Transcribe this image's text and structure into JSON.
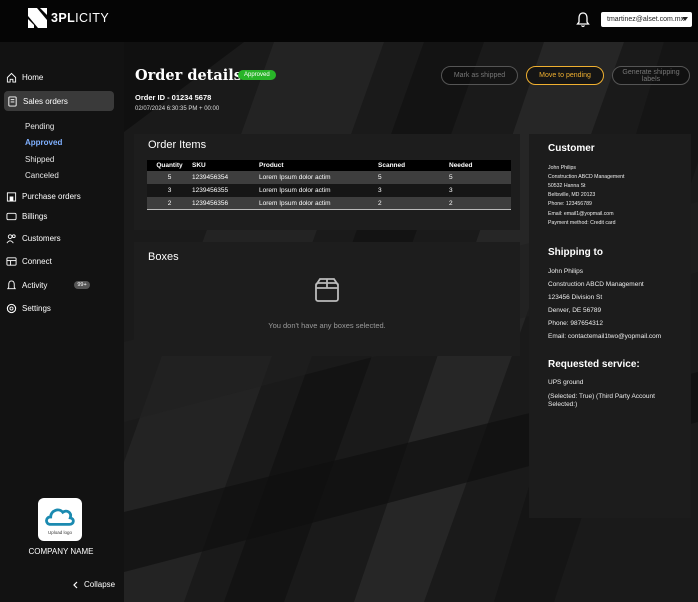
{
  "app": {
    "logo_text_bold": "3PL",
    "logo_text_thin": "ICITY",
    "user_email": "tmartinez@alset.com.mx"
  },
  "sidebar": {
    "home": "Home",
    "sales_orders": "Sales orders",
    "sub": [
      "Pending",
      "Approved",
      "Shipped",
      "Canceled"
    ],
    "purchase_orders": "Purchase orders",
    "billings": "Billings",
    "customers": "Customers",
    "connect": "Connect",
    "activity": "Activity",
    "activity_badge": "99+",
    "settings": "Settings",
    "upload_logo": "Upload logo",
    "company_name": "COMPANY NAME",
    "collapse": "Collapse"
  },
  "order": {
    "title": "Order details",
    "status": "Approved",
    "id_line": "Order ID - 01234 5678",
    "date_line": "02/07/2024 6:30:35 PM + 00:00"
  },
  "actions": {
    "mark_shipped": "Mark as shipped",
    "move_pending": "Move to pending",
    "generate_labels": "Generate shipping labels"
  },
  "items": {
    "title": "Order Items",
    "columns": [
      "Quantity",
      "SKU",
      "Product",
      "Scanned",
      "Needed"
    ],
    "rows": [
      [
        "5",
        "1239456354",
        "Lorem Ipsum dolor actim",
        "5",
        "5"
      ],
      [
        "3",
        "1239456355",
        "Lorem Ipsum dolor actim",
        "3",
        "3"
      ],
      [
        "2",
        "1239456356",
        "Lorem Ipsum dolor actim",
        "2",
        "2"
      ]
    ]
  },
  "boxes": {
    "title": "Boxes",
    "empty": "You don't have any boxes selected."
  },
  "customer": {
    "title": "Customer",
    "lines": [
      "John Philips",
      "Construction ABCD Management",
      "50532 Hanna St",
      "Beltsville, MD 20123",
      "Phone: 123456789",
      "Email: email1@yopmail.com",
      "Payment method: Credit card"
    ]
  },
  "shipping": {
    "title": "Shipping to",
    "lines": [
      "John Philips",
      "Construction ABCD Management",
      "123456 Division St",
      "Denver, DE 56789",
      "Phone: 987654312",
      "Email: contactemail1two@yopmail.com"
    ]
  },
  "service": {
    "title": "Requested service:",
    "line1": "UPS ground",
    "line2": "(Selected: True) (Third Party Account Selected:)"
  }
}
